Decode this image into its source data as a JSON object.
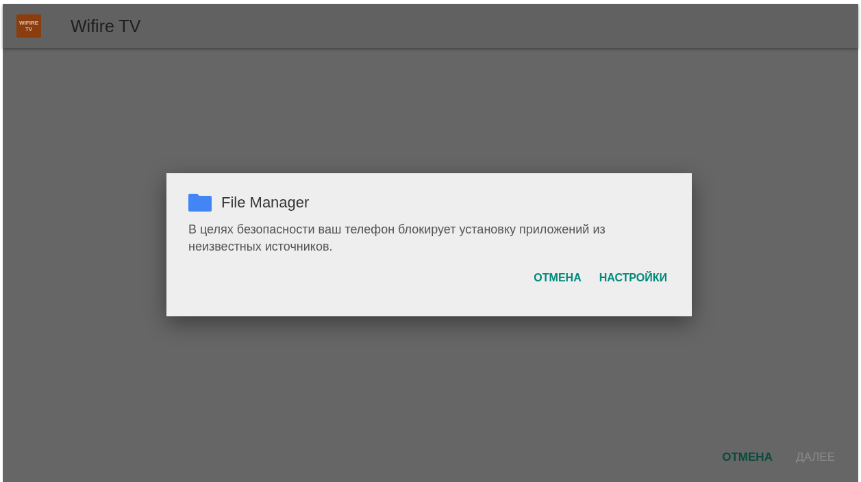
{
  "app_bar": {
    "logo_lines": [
      "WIFIRE",
      "TV"
    ],
    "title": "Wifire TV"
  },
  "footer_buttons": [
    {
      "label": "ОТМЕНА",
      "disabled": false
    },
    {
      "label": "ДАЛЕЕ",
      "disabled": true
    }
  ],
  "dialog": {
    "title": "File Manager",
    "message": "В целях безопасности ваш телефон блокирует установку приложений из неизвестных источников.",
    "buttons": [
      "ОТМЕНА",
      "НАСТРОЙКИ"
    ]
  }
}
